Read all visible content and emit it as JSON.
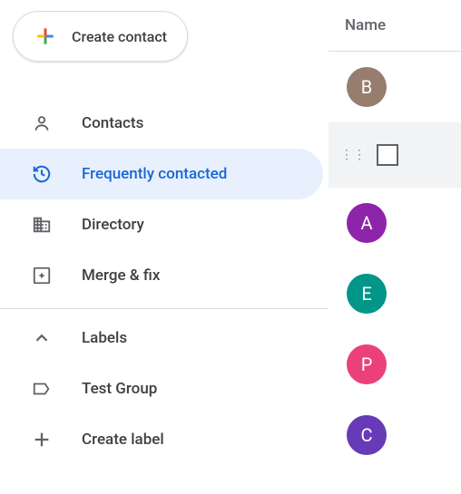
{
  "create": {
    "label": "Create contact"
  },
  "nav": {
    "contacts": "Contacts",
    "frequently": "Frequently contacted",
    "directory": "Directory",
    "merge": "Merge & fix"
  },
  "labels": {
    "heading": "Labels",
    "group1": "Test Group",
    "create": "Create label"
  },
  "columnHeader": "Name",
  "contacts": [
    {
      "initial": "B",
      "color": "#967d6d"
    },
    {
      "initial": "",
      "color": "",
      "selected": true
    },
    {
      "initial": "A",
      "color": "#8e24aa"
    },
    {
      "initial": "E",
      "color": "#009688"
    },
    {
      "initial": "P",
      "color": "#ec407a"
    },
    {
      "initial": "C",
      "color": "#673ab7"
    }
  ]
}
